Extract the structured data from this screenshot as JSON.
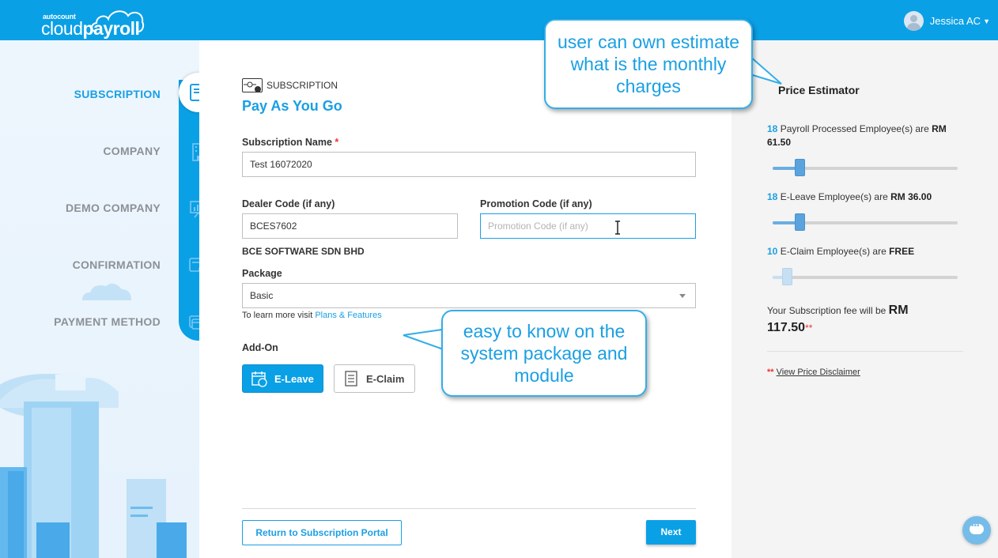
{
  "header": {
    "logo_small": "autocount",
    "logo_main_light": "cloud",
    "logo_main_bold": "payroll",
    "user_name": "Jessica AC",
    "brand_color": "#0aa0e6"
  },
  "steps": [
    {
      "label": "SUBSCRIPTION",
      "active": true,
      "icon": "subscription-form-icon"
    },
    {
      "label": "COMPANY",
      "active": false,
      "icon": "building-icon"
    },
    {
      "label": "DEMO COMPANY",
      "active": false,
      "icon": "presentation-icon"
    },
    {
      "label": "CONFIRMATION",
      "active": false,
      "icon": "confirm-document-icon"
    },
    {
      "label": "PAYMENT METHOD",
      "active": false,
      "icon": "credit-card-icon"
    }
  ],
  "form": {
    "section_tag": "SUBSCRIPTION",
    "title": "Pay As You Go",
    "subscription_name_label": "Subscription Name",
    "required_mark": "*",
    "subscription_name_value": "Test 16072020",
    "dealer_code_label": "Dealer Code (if any)",
    "dealer_code_value": "BCES7602",
    "promotion_code_label": "Promotion Code (if any)",
    "promotion_code_placeholder": "Promotion Code (if any)",
    "dealer_name": "BCE SOFTWARE SDN BHD",
    "package_label": "Package",
    "package_value": "Basic",
    "learn_more_prefix": "To learn more visit",
    "learn_more_link": "Plans & Features",
    "addon_label": "Add-On",
    "addons": [
      {
        "label": "E-Leave",
        "selected": true
      },
      {
        "label": "E-Claim",
        "selected": false
      }
    ],
    "return_button": "Return to Subscription Portal",
    "next_button": "Next"
  },
  "estimator": {
    "title": "Price Estimator",
    "payroll": {
      "count": "18",
      "text": "Payroll Processed Employee(s) are",
      "price": "RM 61.50",
      "slider_fraction": 0.15
    },
    "eleave": {
      "count": "18",
      "text": "E-Leave Employee(s) are",
      "price": "RM 36.00",
      "slider_fraction": 0.15
    },
    "eclaim": {
      "count": "10",
      "text": "E-Claim Employee(s) are",
      "price": "FREE",
      "slider_fraction": 0.08
    },
    "fee_prefix": "Your Subscription fee will be",
    "fee_currency": "RM",
    "fee_amount": "117.50",
    "fee_mark": "**",
    "disclaimer_mark": "**",
    "disclaimer_link": "View Price Disclaimer"
  },
  "callouts": {
    "top": "user can own estimate what is the monthly charges",
    "middle": "easy to know on the system package and module"
  }
}
